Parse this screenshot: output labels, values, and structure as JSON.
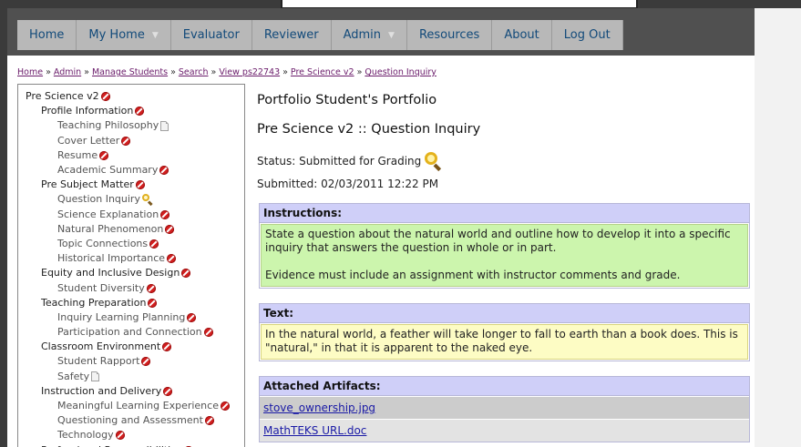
{
  "nav": {
    "items": [
      {
        "label": "Home",
        "dropdown": false
      },
      {
        "label": "My Home",
        "dropdown": true
      },
      {
        "label": "Evaluator",
        "dropdown": false
      },
      {
        "label": "Reviewer",
        "dropdown": false
      },
      {
        "label": "Admin",
        "dropdown": true
      },
      {
        "label": "Resources",
        "dropdown": false
      },
      {
        "label": "About",
        "dropdown": false
      },
      {
        "label": "Log Out",
        "dropdown": false
      }
    ]
  },
  "breadcrumb": {
    "separator": "»",
    "items": [
      "Home",
      "Admin",
      "Manage Students",
      "Search",
      "View ps22743",
      "Pre Science v2",
      "Question Inquiry"
    ]
  },
  "tree": {
    "items": [
      {
        "label": "Pre Science v2",
        "level": 0,
        "status": "not-started"
      },
      {
        "label": "Profile Information",
        "level": 1,
        "status": "not-started"
      },
      {
        "label": "Teaching Philosophy",
        "level": 2,
        "status": "document"
      },
      {
        "label": "Cover Letter",
        "level": 2,
        "status": "not-started"
      },
      {
        "label": "Resume",
        "level": 2,
        "status": "not-started"
      },
      {
        "label": "Academic Summary",
        "level": 2,
        "status": "not-started"
      },
      {
        "label": "Pre Subject Matter",
        "level": 1,
        "status": "not-started"
      },
      {
        "label": "Question Inquiry",
        "level": 2,
        "status": "submitted"
      },
      {
        "label": "Science Explanation",
        "level": 2,
        "status": "not-started"
      },
      {
        "label": "Natural Phenomenon",
        "level": 2,
        "status": "not-started"
      },
      {
        "label": "Topic Connections",
        "level": 2,
        "status": "not-started"
      },
      {
        "label": "Historical Importance",
        "level": 2,
        "status": "not-started"
      },
      {
        "label": "Equity and Inclusive Design",
        "level": 1,
        "status": "not-started"
      },
      {
        "label": "Student Diversity",
        "level": 2,
        "status": "not-started"
      },
      {
        "label": "Teaching Preparation",
        "level": 1,
        "status": "not-started"
      },
      {
        "label": "Inquiry Learning Planning",
        "level": 2,
        "status": "not-started"
      },
      {
        "label": "Participation and Connection",
        "level": 2,
        "status": "not-started"
      },
      {
        "label": "Classroom Environment",
        "level": 1,
        "status": "not-started"
      },
      {
        "label": "Student Rapport",
        "level": 2,
        "status": "not-started"
      },
      {
        "label": "Safety",
        "level": 2,
        "status": "document"
      },
      {
        "label": "Instruction and Delivery",
        "level": 1,
        "status": "not-started"
      },
      {
        "label": "Meaningful Learning Experience",
        "level": 2,
        "status": "not-started"
      },
      {
        "label": "Questioning and Assessment",
        "level": 2,
        "status": "not-started"
      },
      {
        "label": "Technology",
        "level": 2,
        "status": "not-started"
      },
      {
        "label": "Professional Responsibilities",
        "level": 1,
        "status": "not-started"
      }
    ]
  },
  "main": {
    "portfolio_title": "Portfolio Student's Portfolio",
    "section_title": "Pre Science v2 :: Question Inquiry",
    "status_text": "Status: Submitted for Grading",
    "submitted_text": "Submitted: 02/03/2011 12:22 PM",
    "instructions": {
      "heading": "Instructions:",
      "paragraph1": "State a question about the natural world and outline how to develop it into a specific inquiry that answers the question in whole or in part.",
      "paragraph2": "Evidence must include an assignment with instructor comments and grade."
    },
    "text": {
      "heading": "Text:",
      "body": "In the natural world, a feather will take longer to fall to earth than a book does. This is \"natural,\" in that it is apparent to the naked eye."
    },
    "artifacts": {
      "heading": "Attached Artifacts:",
      "files": [
        "stove_ownership.jpg",
        "MathTEKS URL.doc"
      ]
    }
  },
  "colors": {
    "nav_bg": "#505050",
    "nav_item": "#b8b8b8",
    "panel_head": "#cfcff8",
    "instructions_bg": "#ccf5ad",
    "text_bg": "#fdfcc4",
    "not_started_icon": "#d21f1f",
    "submitted_icon": "#e4b21c"
  }
}
